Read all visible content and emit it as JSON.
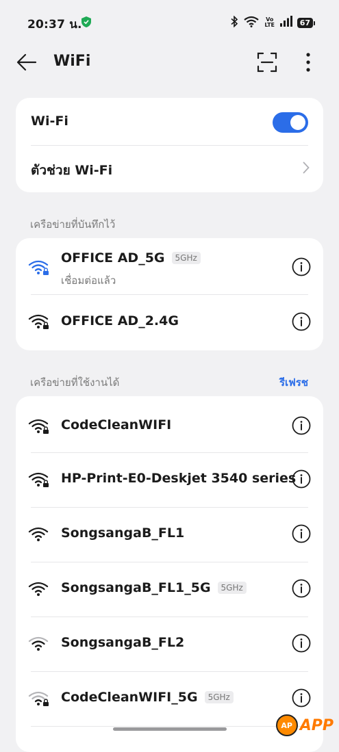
{
  "status_bar": {
    "time": "20:37 น.",
    "battery": "67",
    "volte": "Vo LTE"
  },
  "header": {
    "title": "WiFi"
  },
  "wifi_card": {
    "label": "Wi-Fi",
    "toggle_on": true,
    "assistant_label": "ตัวช่วย Wi-Fi"
  },
  "saved": {
    "label": "เครือข่ายที่บันทึกไว้",
    "networks": [
      {
        "name": "OFFICE AD_5G",
        "badge": "5GHz",
        "status": "เชื่อมต่อแล้ว",
        "icon": "wifi-connected-locked-icon",
        "color": "#2b6de8"
      },
      {
        "name": "OFFICE AD_2.4G",
        "icon": "wifi-locked-icon"
      }
    ]
  },
  "available": {
    "label": "เครือข่ายที่ใช้งานได้",
    "refresh_label": "รีเฟรช",
    "networks": [
      {
        "name": "CodeCleanWIFI",
        "icon": "wifi-locked-icon"
      },
      {
        "name": "HP-Print-E0-Deskjet 3540 series",
        "icon": "wifi-locked-icon"
      },
      {
        "name": "SongsangaB_FL1",
        "icon": "wifi-icon"
      },
      {
        "name": "SongsangaB_FL1_5G",
        "badge": "5GHz",
        "icon": "wifi-icon"
      },
      {
        "name": "SongsangaB_FL2",
        "icon": "wifi-weak-icon"
      },
      {
        "name": "CodeCleanWIFI_5G",
        "badge": "5GHz",
        "icon": "wifi-weak-locked-icon"
      }
    ]
  },
  "watermark": {
    "logo": "AP",
    "text": "APP"
  },
  "colors": {
    "accent": "#2b6de8",
    "background": "#f1f1f3",
    "card": "#ffffff"
  }
}
